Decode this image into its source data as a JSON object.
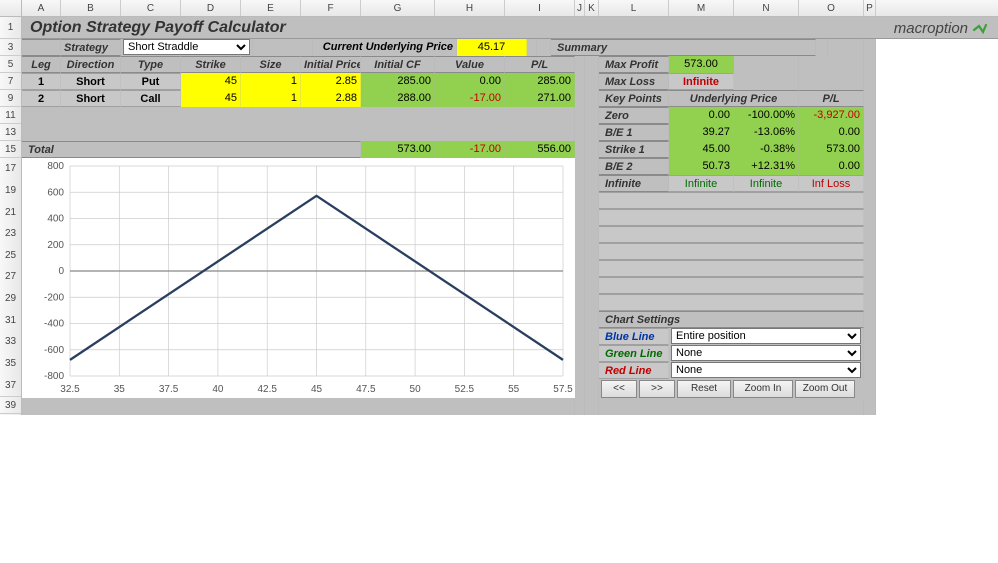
{
  "columns": [
    "A",
    "B",
    "C",
    "D",
    "E",
    "F",
    "G",
    "H",
    "I",
    "J",
    "K",
    "L",
    "M",
    "N",
    "O",
    "P"
  ],
  "visible_row_labels": [
    "1",
    "3",
    "5",
    "7",
    "9",
    "11",
    "13",
    "15",
    "17",
    "19",
    "21",
    "23",
    "25",
    "27",
    "29",
    "31",
    "33",
    "35",
    "37",
    "39"
  ],
  "title": "Option Strategy Payoff Calculator",
  "brand": "macroption",
  "strategy_label": "Strategy",
  "strategy_value": "Short Straddle",
  "cup_label": "Current Underlying Price",
  "cup_value": "45.17",
  "legs_header": [
    "Leg",
    "Direction",
    "Type",
    "Strike",
    "Size",
    "Initial Price",
    "Initial CF",
    "Value",
    "P/L"
  ],
  "legs": [
    {
      "n": "1",
      "dir": "Short",
      "type": "Put",
      "strike": "45",
      "size": "1",
      "ip": "2.85",
      "icf": "285.00",
      "val": "0.00",
      "pl": "285.00"
    },
    {
      "n": "2",
      "dir": "Short",
      "type": "Call",
      "strike": "45",
      "size": "1",
      "ip": "2.88",
      "icf": "288.00",
      "val": "-17.00",
      "pl": "271.00"
    }
  ],
  "total_label": "Total",
  "total": {
    "icf": "573.00",
    "val": "-17.00",
    "pl": "556.00"
  },
  "summary_label": "Summary",
  "max_profit_label": "Max Profit",
  "max_profit": "573.00",
  "max_loss_label": "Max Loss",
  "max_loss": "Infinite",
  "keypoints_label": "Key Points",
  "kp_under": "Underlying Price",
  "kp_pl": "P/L",
  "kp": [
    {
      "name": "Zero",
      "u": "0.00",
      "pct": "-100.00%",
      "pl": "-3,927.00",
      "pl_red": true
    },
    {
      "name": "B/E 1",
      "u": "39.27",
      "pct": "-13.06%",
      "pl": "0.00"
    },
    {
      "name": "Strike 1",
      "u": "45.00",
      "pct": "-0.38%",
      "pl": "573.00"
    },
    {
      "name": "B/E 2",
      "u": "50.73",
      "pct": "+12.31%",
      "pl": "0.00"
    },
    {
      "name": "Infinite",
      "u": "Infinite",
      "pct": "Infinite",
      "pl": "Inf Loss",
      "pl_red": true,
      "u_green_txt": true
    }
  ],
  "chart_settings_label": "Chart Settings",
  "blue_label": "Blue Line",
  "blue_val": "Entire position",
  "green_label": "Green Line",
  "green_val": "None",
  "red_label": "Red Line",
  "red_val": "None",
  "btn_prev": "<<",
  "btn_next": ">>",
  "btn_reset": "Reset",
  "btn_zin": "Zoom In",
  "btn_zout": "Zoom Out",
  "chart_data": {
    "type": "line",
    "xlabel": "",
    "ylabel": "",
    "xlim": [
      32.5,
      57.5
    ],
    "ylim": [
      -800,
      800
    ],
    "x_ticks": [
      32.5,
      35,
      37.5,
      40,
      42.5,
      45,
      47.5,
      50,
      52.5,
      55,
      57.5
    ],
    "y_ticks": [
      -800,
      -600,
      -400,
      -200,
      0,
      200,
      400,
      600,
      800
    ],
    "series": [
      {
        "name": "Entire position",
        "color": "#2a3f5f",
        "x": [
          32.5,
          45,
          57.5
        ],
        "y": [
          -677,
          573,
          -677
        ]
      }
    ]
  }
}
